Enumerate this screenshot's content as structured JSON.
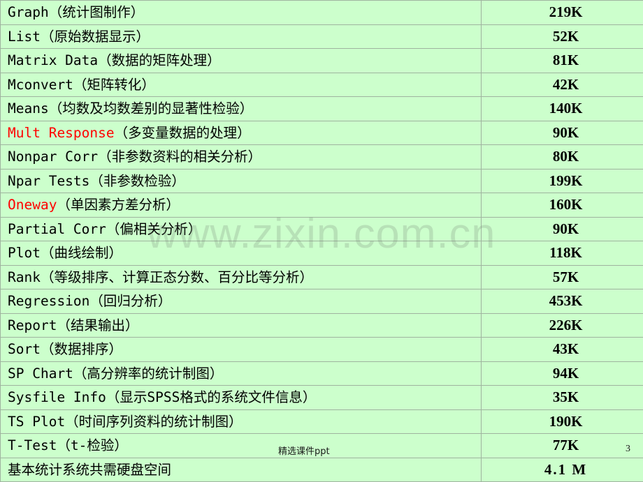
{
  "watermark": {
    "text": "www.zixin.com.cn"
  },
  "footer": {
    "note": "精选课件ppt",
    "slide_number": "3"
  },
  "colors": {
    "row_green": "#CCFFCC",
    "row_orange": "#FCCB95",
    "border": "#9FB39F",
    "accent_red": "#FF0000",
    "text_black": "#000000"
  },
  "table": {
    "rows": [
      {
        "name": "Graph（统计图制作）",
        "size": "219K",
        "style": "red"
      },
      {
        "name": "List（原始数据显示）",
        "size": "52K",
        "style": "black"
      },
      {
        "name": "Matrix Data（数据的矩阵处理）",
        "size": "81K",
        "style": "black"
      },
      {
        "name": "Mconvert（矩阵转化）",
        "size": "42K",
        "style": "black"
      },
      {
        "name": "Means（均数及均数差别的显著性检验）",
        "size": "140K",
        "style": "black"
      },
      {
        "name": "Mult Response（多变量数据的处理）",
        "size": "90K",
        "style": "mixed",
        "en": "Mult Response",
        "cn": "（多变量数据的处理）"
      },
      {
        "name": "Nonpar Corr（非参数资料的相关分析）",
        "size": "80K",
        "style": "black"
      },
      {
        "name": "Npar Tests（非参数检验）",
        "size": "199K",
        "style": "black"
      },
      {
        "name": "Oneway（单因素方差分析）",
        "size": "160K",
        "style": "mixed",
        "en": "Oneway",
        "cn": "（单因素方差分析）"
      },
      {
        "name": "Partial Corr（偏相关分析）",
        "size": "90K",
        "style": "red"
      },
      {
        "name": "Plot（曲线绘制）",
        "size": "118K",
        "style": "red"
      },
      {
        "name": "Rank（等级排序、计算正态分数、百分比等分析）",
        "size": "57K",
        "style": "black"
      },
      {
        "name": "Regression（回归分析）",
        "size": "453K",
        "style": "red"
      },
      {
        "name": "Report（结果输出）",
        "size": "226K",
        "style": "black"
      },
      {
        "name": "Sort（数据排序）",
        "size": "43K",
        "style": "black"
      },
      {
        "name": "SP Chart（高分辨率的统计制图）",
        "size": "94K",
        "style": "black"
      },
      {
        "name": "Sysfile Info（显示SPSS格式的系统文件信息）",
        "size": "35K",
        "style": "black"
      },
      {
        "name": "TS Plot（时间序列资料的统计制图）",
        "size": "190K",
        "style": "black"
      },
      {
        "name": "T-Test（t-检验）",
        "size": "77K",
        "style": "red"
      },
      {
        "name": "基本统计系统共需硬盘空间",
        "size": "4.1 M",
        "style": "summary"
      }
    ]
  }
}
